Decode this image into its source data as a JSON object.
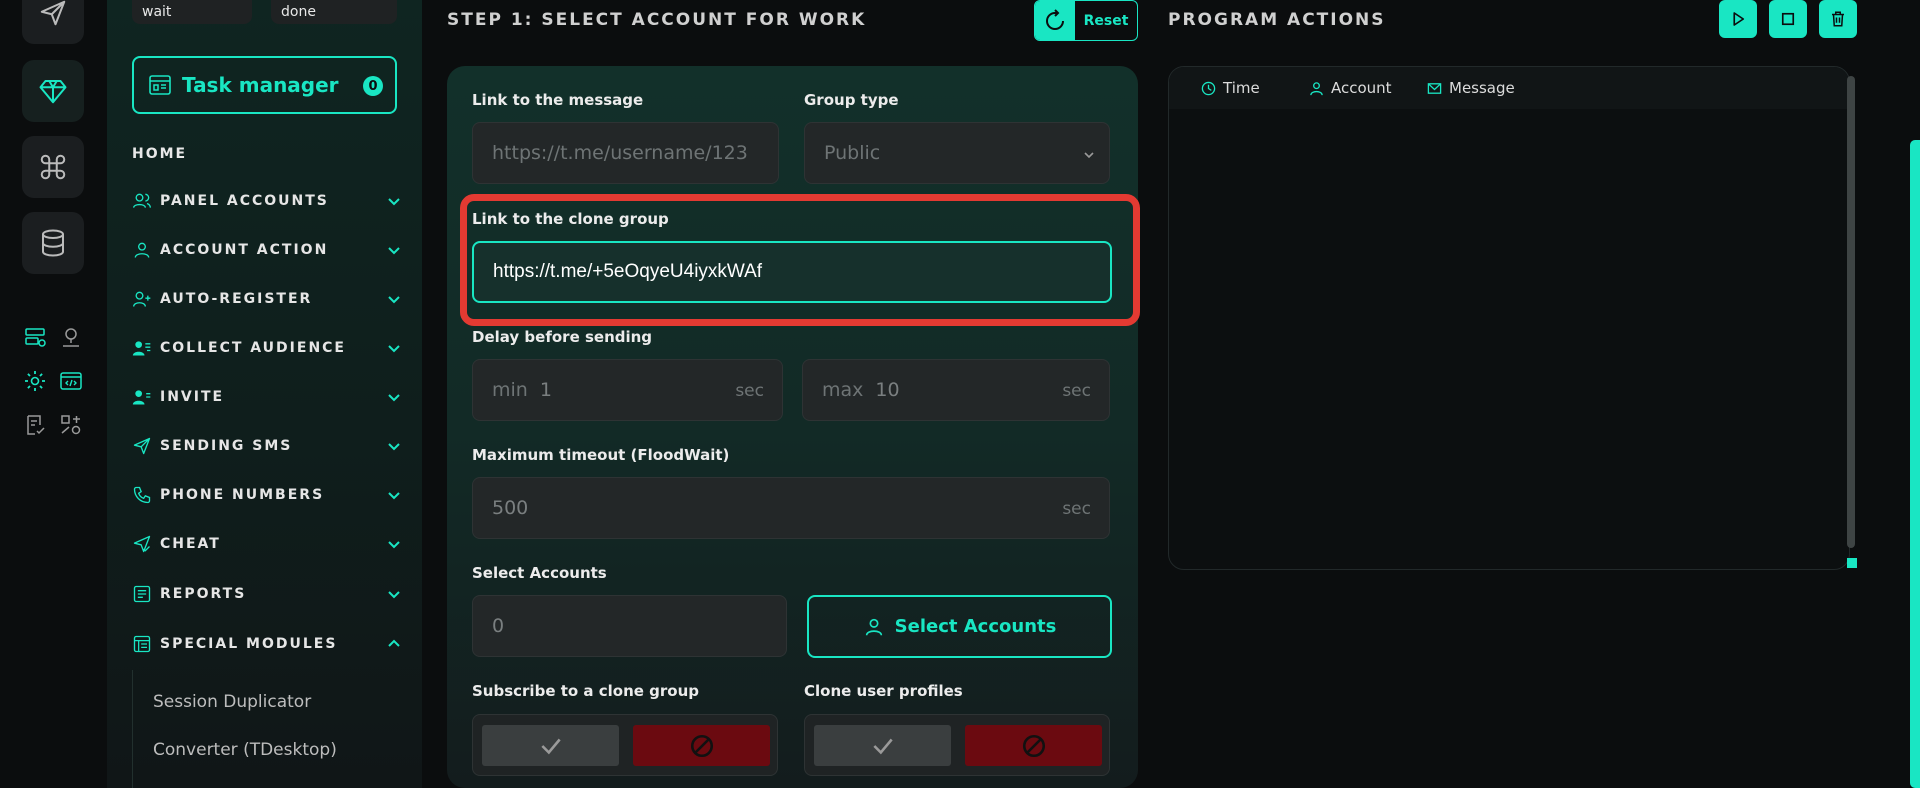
{
  "sidebar": {
    "pills": [
      "wait",
      "done"
    ],
    "task_manager": {
      "label": "Task manager",
      "count": "0"
    },
    "home": "HOME",
    "items": [
      {
        "label": "PANEL ACCOUNTS"
      },
      {
        "label": "ACCOUNT ACTION"
      },
      {
        "label": "AUTO-REGISTER"
      },
      {
        "label": "COLLECT AUDIENCE"
      },
      {
        "label": "INVITE"
      },
      {
        "label": "SENDING SMS"
      },
      {
        "label": "PHONE NUMBERS"
      },
      {
        "label": "CHEAT"
      },
      {
        "label": "REPORTS"
      },
      {
        "label": "SPECIAL MODULES"
      }
    ],
    "sub_items": [
      "Session Duplicator",
      "Converter (TDesktop)"
    ]
  },
  "step": {
    "title": "STEP 1: SELECT ACCOUNT FOR WORK",
    "reset_label": "Reset",
    "link_message": {
      "label": "Link to the message",
      "placeholder": "https://t.me/username/123"
    },
    "group_type": {
      "label": "Group type",
      "value": "Public"
    },
    "clone_group": {
      "label": "Link to the clone group",
      "value": "https://t.me/+5eOqyeU4iyxkWAf"
    },
    "delay": {
      "label": "Delay before sending",
      "min_prefix": "min",
      "min_value": "1",
      "max_prefix": "max",
      "max_value": "10",
      "unit": "sec"
    },
    "timeout": {
      "label": "Maximum timeout (FloodWait)",
      "value": "500",
      "unit": "sec"
    },
    "select_accounts": {
      "label": "Select Accounts",
      "count": "0",
      "button": "Select Accounts"
    },
    "subscribe": {
      "label": "Subscribe to a clone group"
    },
    "clone_profiles": {
      "label": "Clone user profiles"
    }
  },
  "actions": {
    "title": "PROGRAM ACTIONS",
    "columns": [
      "Time",
      "Account",
      "Message"
    ]
  },
  "colors": {
    "accent": "#19e6c3",
    "highlight": "#e33a32",
    "danger": "#6b0a10"
  }
}
